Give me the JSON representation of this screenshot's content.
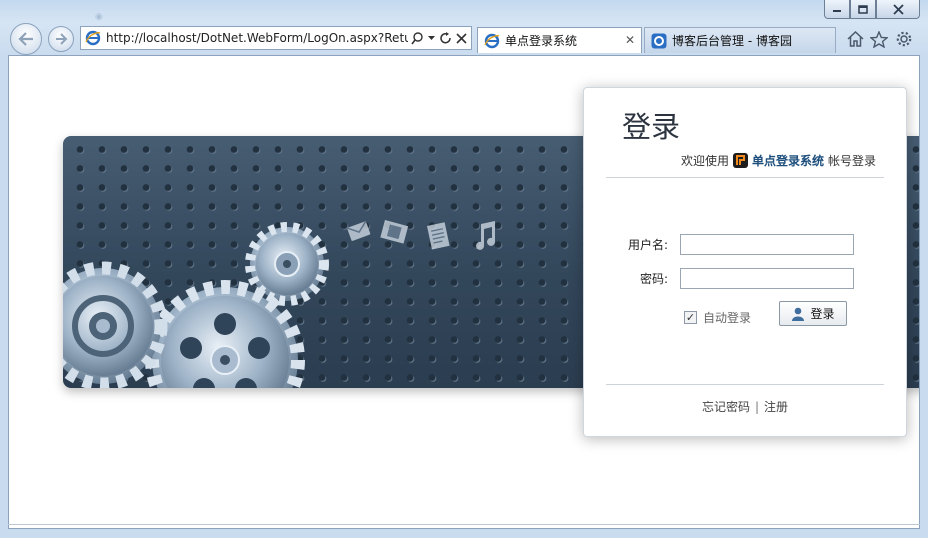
{
  "browser": {
    "address_url": "http://localhost/DotNet.WebForm/LogOn.aspx?Retu",
    "tabs": [
      {
        "title": "单点登录系统",
        "active": true
      },
      {
        "title": "博客后台管理 - 博客园",
        "active": false
      }
    ],
    "accent": "#2b5d93"
  },
  "login": {
    "title": "登录",
    "welcome_prefix": "欢迎使用",
    "system_name": "单点登录系统",
    "welcome_suffix": "帐号登录",
    "username_label": "用户名:",
    "username_value": "",
    "password_label": "密码:",
    "password_value": "",
    "remember_label": "自动登录",
    "remember_checked": true,
    "login_button": "登录",
    "forgot_link": "忘记密码",
    "register_link": "注册",
    "link_separator": "|"
  },
  "banner": {
    "icons": [
      "mail-icon",
      "film-icon",
      "document-icon",
      "music-note-icon"
    ]
  }
}
